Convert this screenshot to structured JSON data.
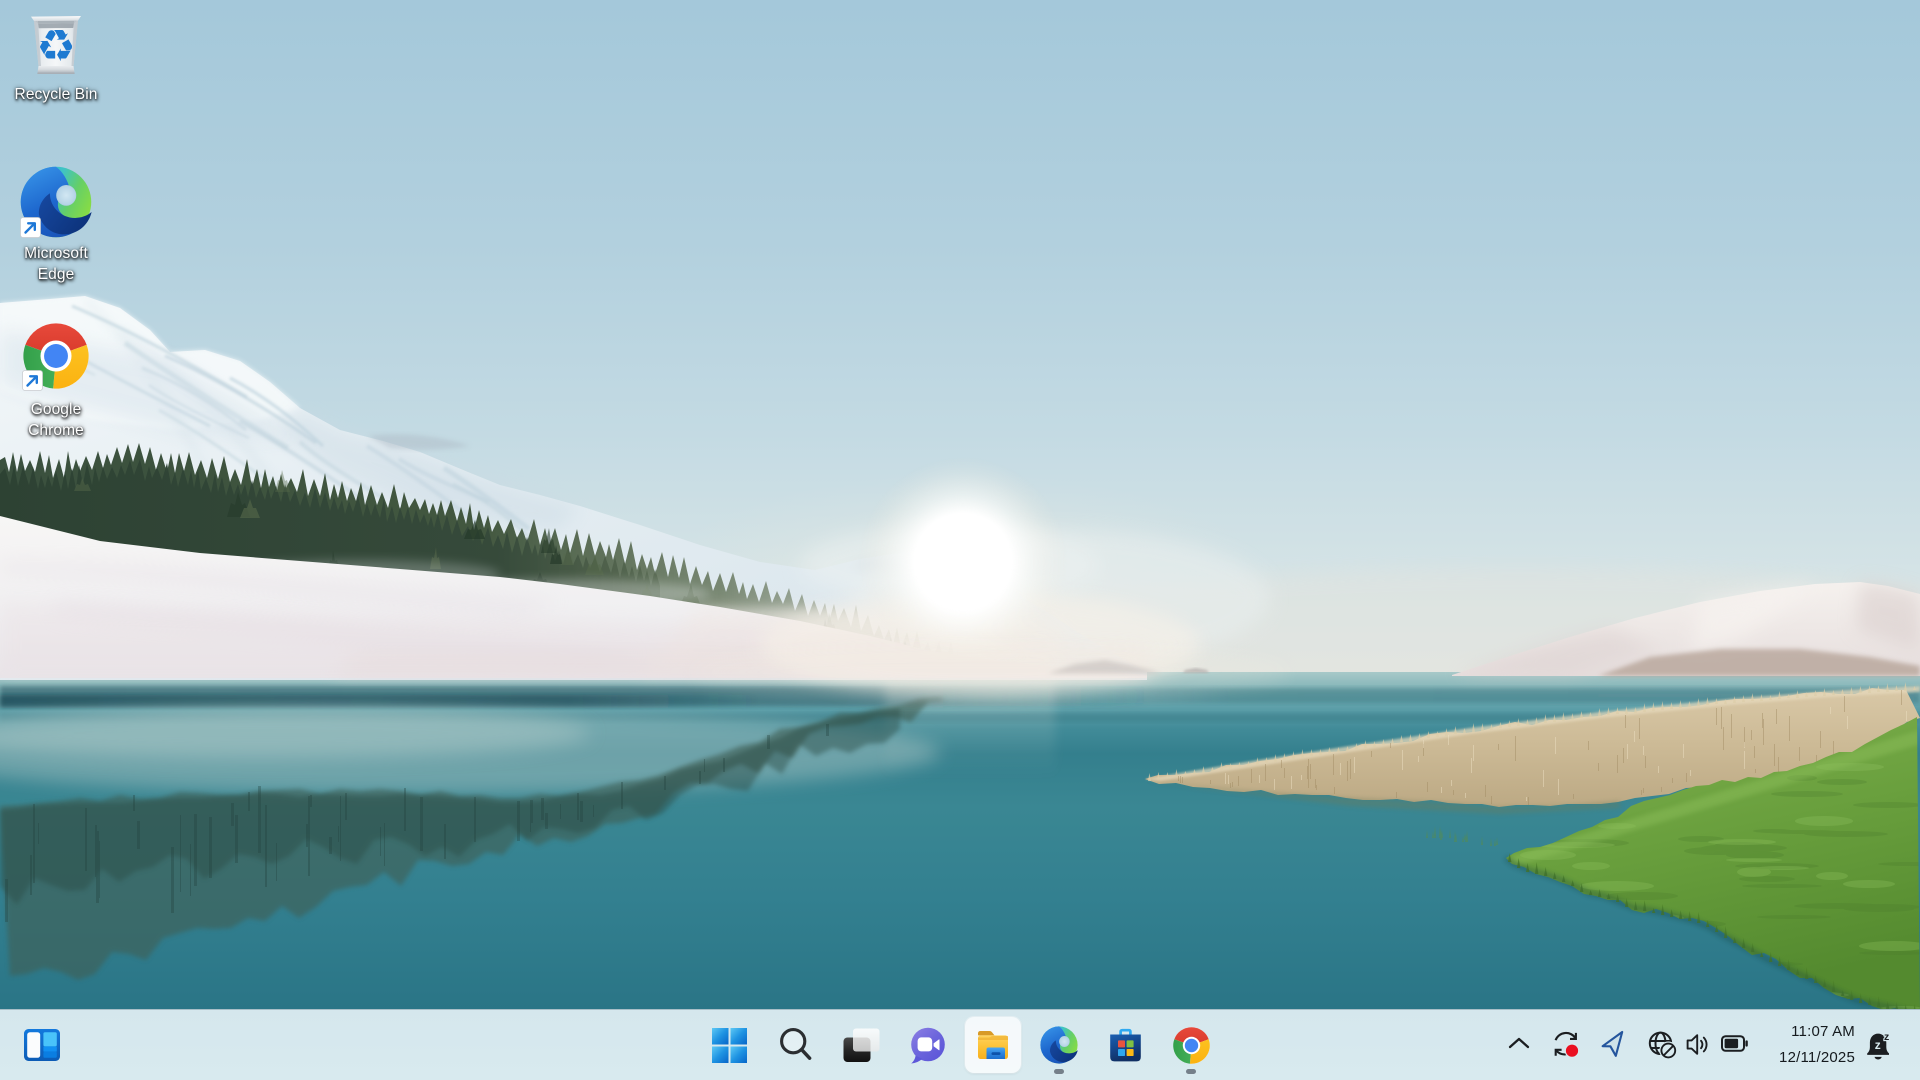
{
  "wallpaper": {
    "description": "lake-landscape-wallpaper",
    "colors": {
      "sky_top": "#a3c6d8",
      "water": "#2f7d8e",
      "snow": "#eef2f4",
      "grass_green": "#6aa348",
      "grass_tan": "#d2c1a0"
    }
  },
  "desktop": {
    "icons": [
      {
        "id": "recycle-bin",
        "label": "Recycle Bin"
      },
      {
        "id": "microsoft-edge",
        "lines": [
          "Microsoft",
          "Edge"
        ]
      },
      {
        "id": "google-chrome",
        "lines": [
          "Google",
          "Chrome"
        ]
      }
    ]
  },
  "taskbar": {
    "color": "#d7e9ee",
    "buttons": [
      {
        "id": "widgets",
        "icon": "widgets-icon"
      },
      {
        "id": "start",
        "icon": "windows-logo-icon"
      },
      {
        "id": "search",
        "icon": "search-icon"
      },
      {
        "id": "task-view",
        "icon": "task-view-icon"
      },
      {
        "id": "chat",
        "icon": "chat-icon"
      },
      {
        "id": "file-explorer",
        "icon": "folder-icon",
        "state": "highlighted"
      },
      {
        "id": "edge",
        "icon": "edge-icon",
        "running": true
      },
      {
        "id": "store",
        "icon": "store-icon"
      },
      {
        "id": "chrome",
        "icon": "chrome-icon",
        "running": true
      }
    ],
    "tray": {
      "icons": [
        "chevron-up-icon",
        "sync-icon",
        "location-icon",
        "globe-offline-icon",
        "volume-icon",
        "battery-icon"
      ],
      "sync_badge_color": "#e81123"
    },
    "clock": {
      "time": "11:07 AM",
      "date": "12/11/2025"
    },
    "notification": {
      "icon": "bell-dnd-icon"
    }
  }
}
